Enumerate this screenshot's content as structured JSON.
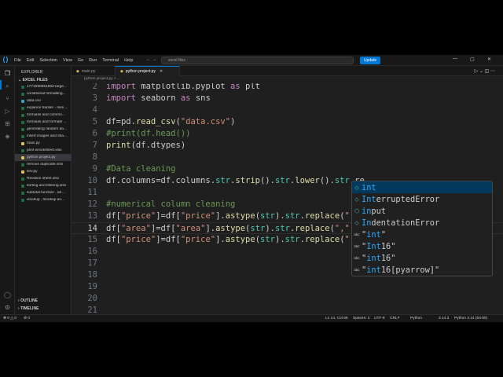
{
  "titlebar": {
    "menu": [
      "File",
      "Edit",
      "Selection",
      "View",
      "Go",
      "Run",
      "Terminal",
      "Help"
    ],
    "command_center": "excel files",
    "update_label": "Update"
  },
  "sidebar": {
    "title": "EXPLORER",
    "folder": "EXCEL FILES",
    "files": [
      {
        "name": "1771590651962-large...",
        "color": "#1d6f42"
      },
      {
        "name": "conditional formatting...",
        "color": "#1d6f42"
      },
      {
        "name": "data.csv",
        "color": "#3e9bd4"
      },
      {
        "name": "expance tracker - mini ...",
        "color": "#1d6f42"
      },
      {
        "name": "formulas and commo...",
        "color": "#1d6f42"
      },
      {
        "name": "formulas and formate ...",
        "color": "#1d6f42"
      },
      {
        "name": "generating random da...",
        "color": "#1d6f42"
      },
      {
        "name": "insert images and sha...",
        "color": "#1d6f42"
      },
      {
        "name": "main.py",
        "color": "#e2c04c"
      },
      {
        "name": "print wroxksheet.xlsx",
        "color": "#1d6f42"
      },
      {
        "name": "python project.py",
        "color": "#e2c04c"
      },
      {
        "name": "remove duplicate.xlsx",
        "color": "#1d6f42"
      },
      {
        "name": "sev.py",
        "color": "#e2c04c"
      },
      {
        "name": "Revision sheet.xlsx",
        "color": "#1d6f42"
      },
      {
        "name": "sorting and filtering.xlsx",
        "color": "#1d6f42"
      },
      {
        "name": "subtotal function , all ...",
        "color": "#1d6f42"
      },
      {
        "name": "vlookup , hlookup an...",
        "color": "#1d6f42"
      }
    ],
    "selected_index": 10,
    "outline_label": "OUTLINE",
    "timeline_label": "TIMELINE"
  },
  "tabs": [
    {
      "label": "main.py"
    },
    {
      "label": "python project.py"
    }
  ],
  "active_tab": 1,
  "breadcrumb": "python project.py > ...",
  "editor": {
    "lines": [
      {
        "n": "2",
        "code": "import matplotlib.pyplot as plt"
      },
      {
        "n": "3",
        "code": "import seaborn as sns"
      },
      {
        "n": "4",
        "code": ""
      },
      {
        "n": "5",
        "code": "df=pd.read_csv(\"data.csv\")"
      },
      {
        "n": "6",
        "code": "#print(df.head())"
      },
      {
        "n": "7",
        "code": "print(df.dtypes)"
      },
      {
        "n": "8",
        "code": ""
      },
      {
        "n": "9",
        "code": "#Data cleaning"
      },
      {
        "n": "10",
        "code": "df.columns=df.columns.str.strip().str.lower().str.re"
      },
      {
        "n": "11",
        "code": ""
      },
      {
        "n": "12",
        "code": "#numerical column cleaning"
      },
      {
        "n": "13",
        "code": "df[\"price\"]=df[\"price\"].astype(str).str.replace(\",\",\""
      },
      {
        "n": "14",
        "code": "df[\"area\"]=df[\"area\"].astype(str).str.replace(\",\",\"\").astype(int)"
      },
      {
        "n": "15",
        "code": "df[\"price\"]=df[\"price\"].astype(str).str.replace(\",\",\"\").astype(float)"
      },
      {
        "n": "16",
        "code": ""
      },
      {
        "n": "17",
        "code": ""
      },
      {
        "n": "18",
        "code": ""
      },
      {
        "n": "19",
        "code": ""
      },
      {
        "n": "20",
        "code": ""
      },
      {
        "n": "21",
        "code": ""
      }
    ],
    "current_line": "14"
  },
  "suggestions": [
    {
      "label": "int",
      "kind": "class"
    },
    {
      "label": "InterruptedError",
      "kind": "class"
    },
    {
      "label": "input",
      "kind": "function"
    },
    {
      "label": "IndentationError",
      "kind": "class"
    },
    {
      "label": "\"int\"",
      "kind": "text"
    },
    {
      "label": "\"Int16\"",
      "kind": "text"
    },
    {
      "label": "\"int16\"",
      "kind": "text"
    },
    {
      "label": "\"int16[pyarrow]\"",
      "kind": "text"
    }
  ],
  "statusbar": {
    "problems": "⊗ 0 △ 0",
    "ports": "⊘ 0",
    "position": "Ln 14, Col 65",
    "spaces": "Spaces: 4",
    "encoding": "UTF-8",
    "eol": "CRLF",
    "language": "Python",
    "version": "3.14.3",
    "interpreter": "Python 3.14 (64-bit)"
  }
}
